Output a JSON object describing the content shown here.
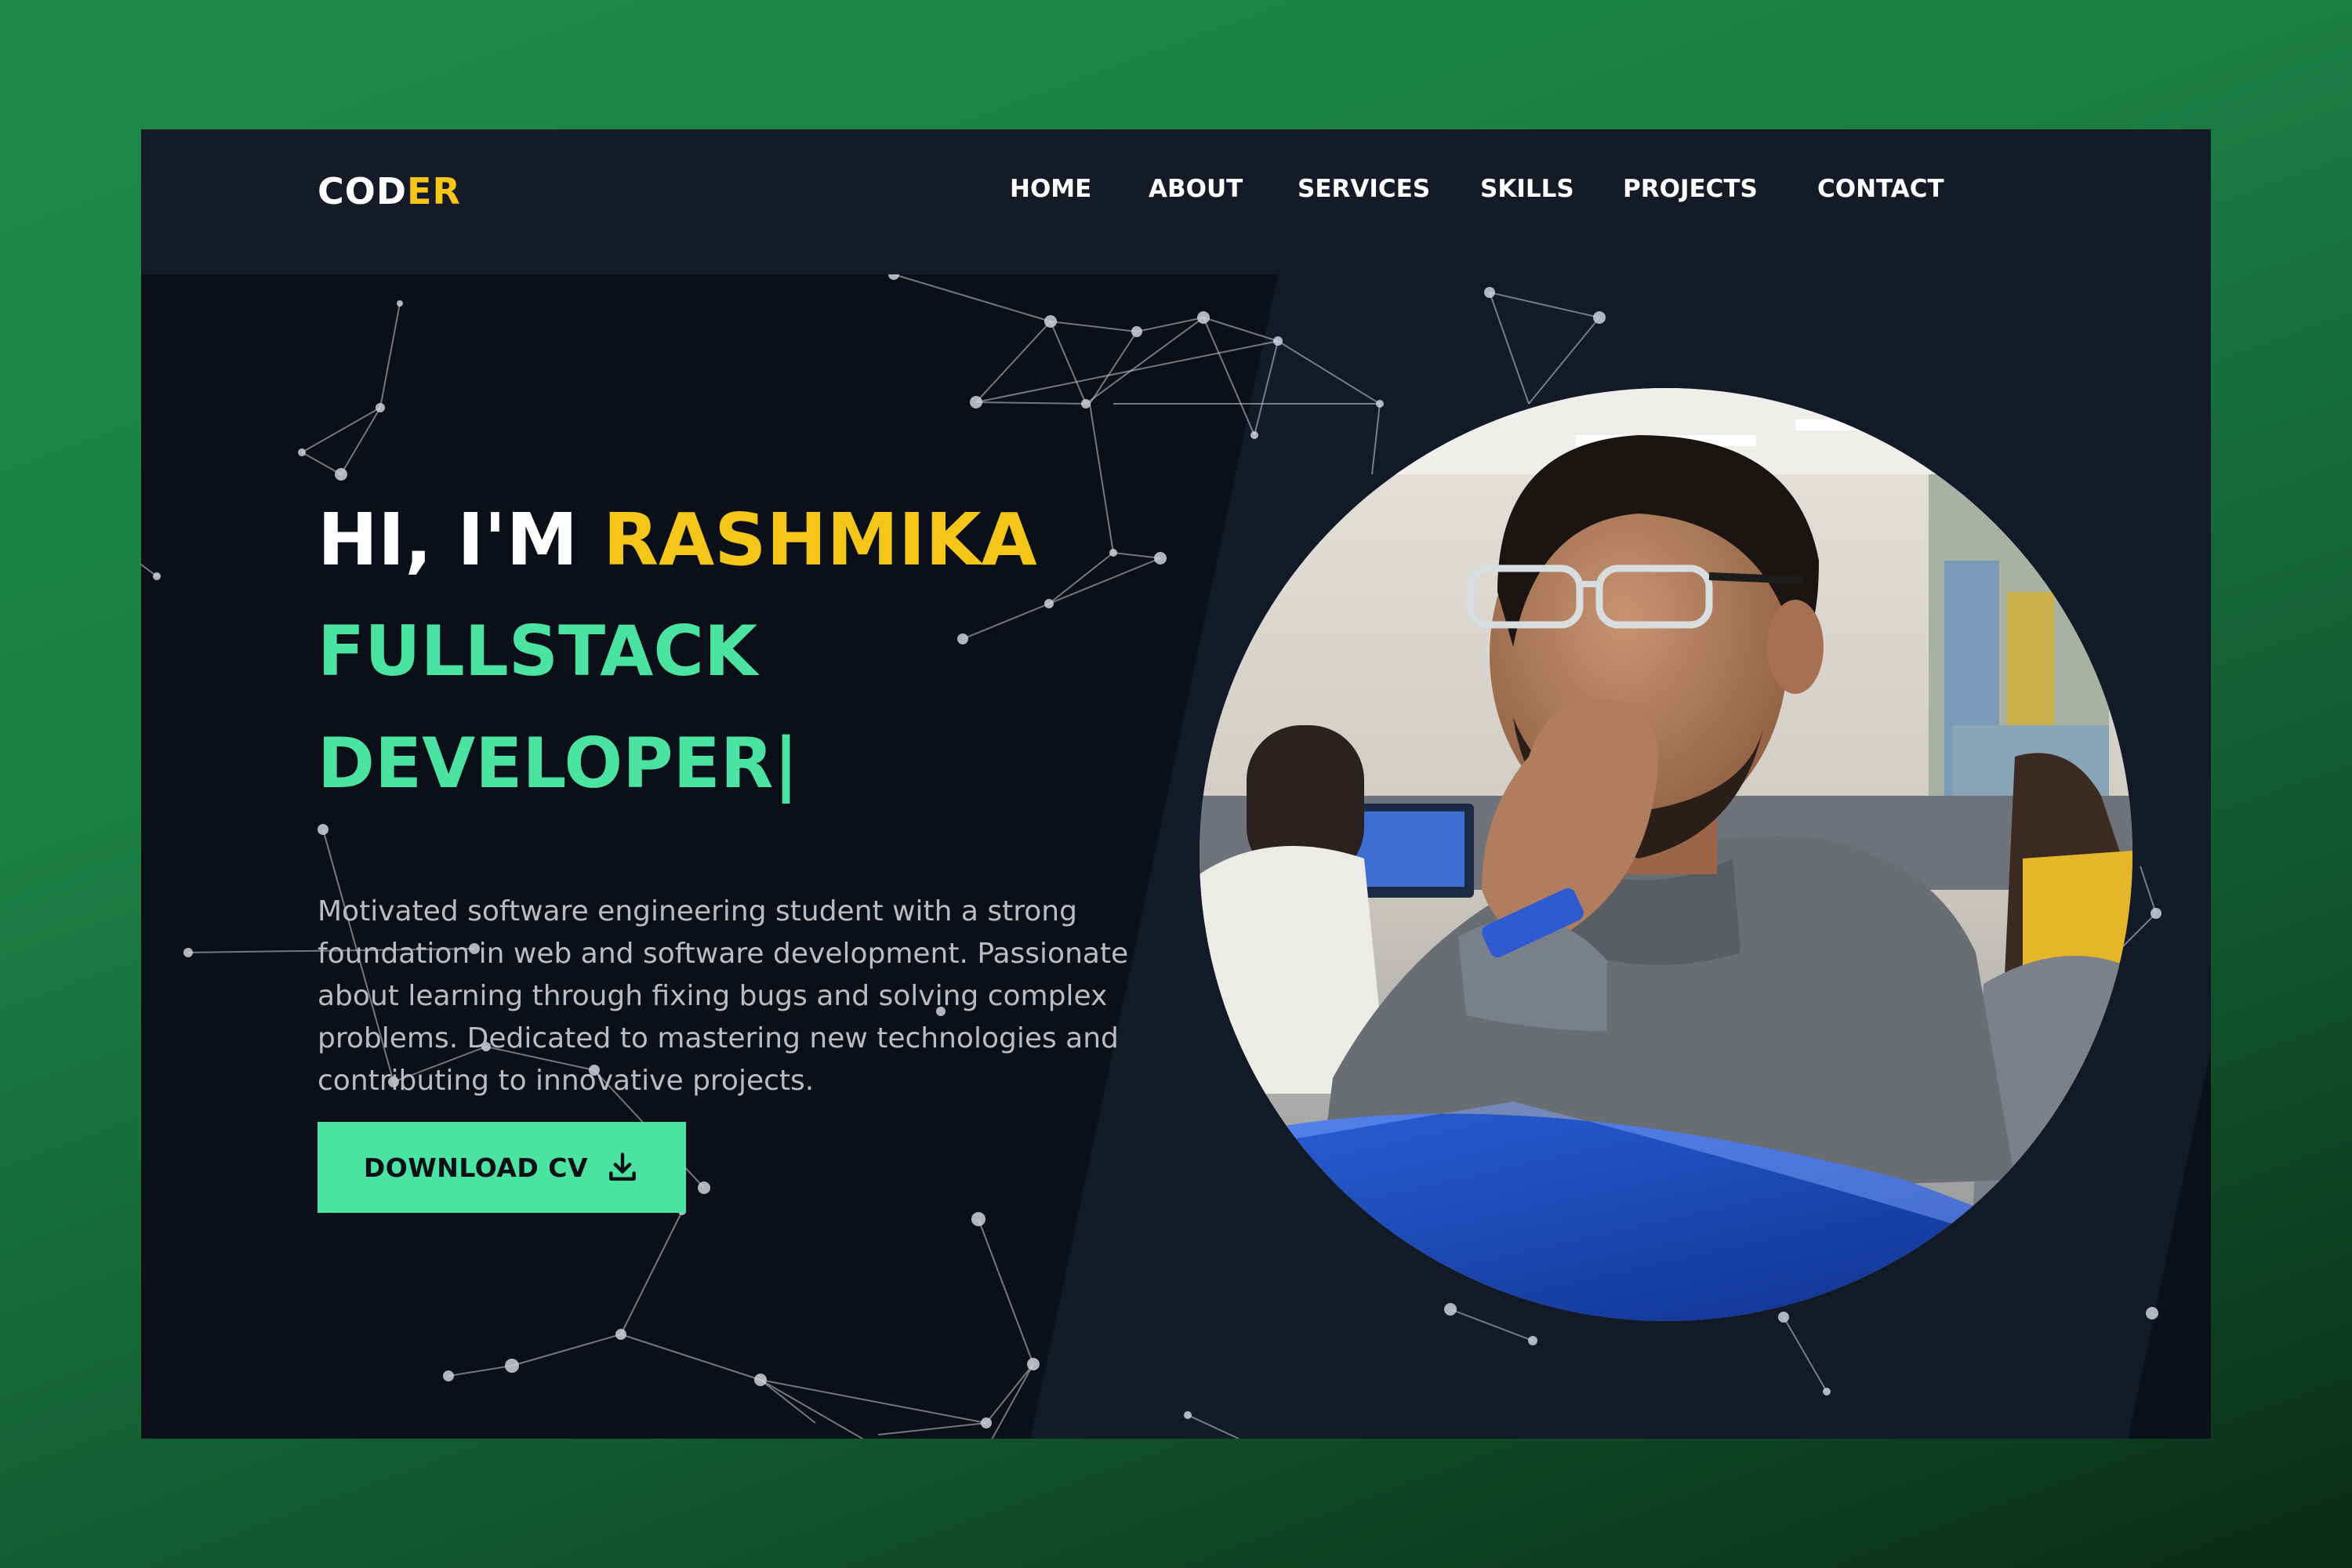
{
  "colors": {
    "background_outer": "#1f8a4c",
    "page_bg": "#0b0f18",
    "navbar_bg": "#141a26",
    "accent_yellow": "#f5c518",
    "accent_green": "#4be3a1",
    "text_white": "#ffffff",
    "text_muted": "#b6bcc8"
  },
  "header": {
    "logo_main": "COD",
    "logo_accent": "ER",
    "nav": [
      "HOME",
      "ABOUT",
      "SERVICES",
      "SKILLS",
      "PROJECTS",
      "CONTACT"
    ]
  },
  "hero": {
    "greeting": "HI, I'M",
    "name": "RASHMIKA",
    "role_line1": "FULLSTACK",
    "role_line2": "DEVELOPER",
    "cursor": "|",
    "description": "Motivated software engineering student with a strong foundation in web and software development. Passionate about learning through fixing bugs and solving complex problems. Dedicated to mastering new technologies and contributing to innovative projects.",
    "cta_label": "DOWNLOAD CV",
    "cta_icon": "download-icon"
  },
  "portrait": {
    "icon": "profile-photo"
  }
}
